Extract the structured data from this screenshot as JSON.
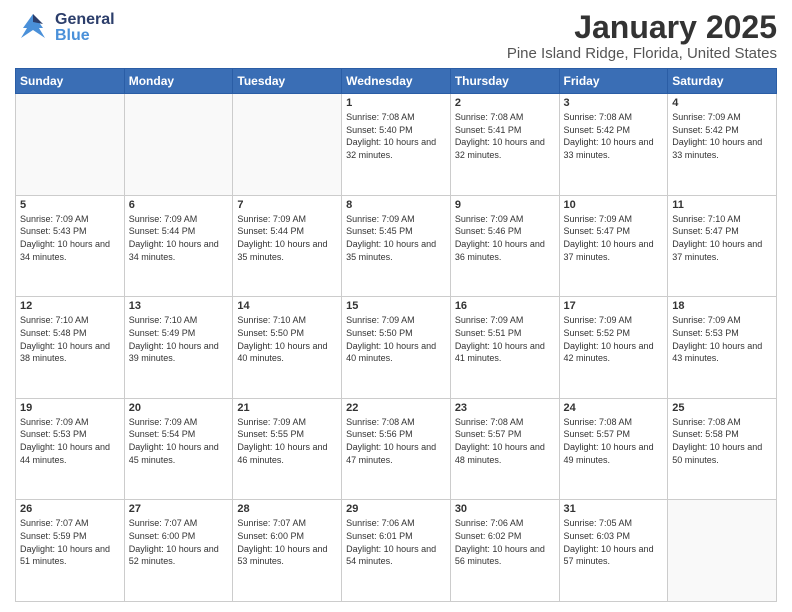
{
  "header": {
    "logo": {
      "general": "General",
      "blue": "Blue"
    },
    "title": "January 2025",
    "location": "Pine Island Ridge, Florida, United States"
  },
  "weekdays": [
    "Sunday",
    "Monday",
    "Tuesday",
    "Wednesday",
    "Thursday",
    "Friday",
    "Saturday"
  ],
  "weeks": [
    [
      {
        "day": "",
        "empty": true
      },
      {
        "day": "",
        "empty": true
      },
      {
        "day": "",
        "empty": true
      },
      {
        "day": "1",
        "sunrise": "7:08 AM",
        "sunset": "5:40 PM",
        "daylight": "10 hours and 32 minutes."
      },
      {
        "day": "2",
        "sunrise": "7:08 AM",
        "sunset": "5:41 PM",
        "daylight": "10 hours and 32 minutes."
      },
      {
        "day": "3",
        "sunrise": "7:08 AM",
        "sunset": "5:42 PM",
        "daylight": "10 hours and 33 minutes."
      },
      {
        "day": "4",
        "sunrise": "7:09 AM",
        "sunset": "5:42 PM",
        "daylight": "10 hours and 33 minutes."
      }
    ],
    [
      {
        "day": "5",
        "sunrise": "7:09 AM",
        "sunset": "5:43 PM",
        "daylight": "10 hours and 34 minutes."
      },
      {
        "day": "6",
        "sunrise": "7:09 AM",
        "sunset": "5:44 PM",
        "daylight": "10 hours and 34 minutes."
      },
      {
        "day": "7",
        "sunrise": "7:09 AM",
        "sunset": "5:44 PM",
        "daylight": "10 hours and 35 minutes."
      },
      {
        "day": "8",
        "sunrise": "7:09 AM",
        "sunset": "5:45 PM",
        "daylight": "10 hours and 35 minutes."
      },
      {
        "day": "9",
        "sunrise": "7:09 AM",
        "sunset": "5:46 PM",
        "daylight": "10 hours and 36 minutes."
      },
      {
        "day": "10",
        "sunrise": "7:09 AM",
        "sunset": "5:47 PM",
        "daylight": "10 hours and 37 minutes."
      },
      {
        "day": "11",
        "sunrise": "7:10 AM",
        "sunset": "5:47 PM",
        "daylight": "10 hours and 37 minutes."
      }
    ],
    [
      {
        "day": "12",
        "sunrise": "7:10 AM",
        "sunset": "5:48 PM",
        "daylight": "10 hours and 38 minutes."
      },
      {
        "day": "13",
        "sunrise": "7:10 AM",
        "sunset": "5:49 PM",
        "daylight": "10 hours and 39 minutes."
      },
      {
        "day": "14",
        "sunrise": "7:10 AM",
        "sunset": "5:50 PM",
        "daylight": "10 hours and 40 minutes."
      },
      {
        "day": "15",
        "sunrise": "7:09 AM",
        "sunset": "5:50 PM",
        "daylight": "10 hours and 40 minutes."
      },
      {
        "day": "16",
        "sunrise": "7:09 AM",
        "sunset": "5:51 PM",
        "daylight": "10 hours and 41 minutes."
      },
      {
        "day": "17",
        "sunrise": "7:09 AM",
        "sunset": "5:52 PM",
        "daylight": "10 hours and 42 minutes."
      },
      {
        "day": "18",
        "sunrise": "7:09 AM",
        "sunset": "5:53 PM",
        "daylight": "10 hours and 43 minutes."
      }
    ],
    [
      {
        "day": "19",
        "sunrise": "7:09 AM",
        "sunset": "5:53 PM",
        "daylight": "10 hours and 44 minutes."
      },
      {
        "day": "20",
        "sunrise": "7:09 AM",
        "sunset": "5:54 PM",
        "daylight": "10 hours and 45 minutes."
      },
      {
        "day": "21",
        "sunrise": "7:09 AM",
        "sunset": "5:55 PM",
        "daylight": "10 hours and 46 minutes."
      },
      {
        "day": "22",
        "sunrise": "7:08 AM",
        "sunset": "5:56 PM",
        "daylight": "10 hours and 47 minutes."
      },
      {
        "day": "23",
        "sunrise": "7:08 AM",
        "sunset": "5:57 PM",
        "daylight": "10 hours and 48 minutes."
      },
      {
        "day": "24",
        "sunrise": "7:08 AM",
        "sunset": "5:57 PM",
        "daylight": "10 hours and 49 minutes."
      },
      {
        "day": "25",
        "sunrise": "7:08 AM",
        "sunset": "5:58 PM",
        "daylight": "10 hours and 50 minutes."
      }
    ],
    [
      {
        "day": "26",
        "sunrise": "7:07 AM",
        "sunset": "5:59 PM",
        "daylight": "10 hours and 51 minutes."
      },
      {
        "day": "27",
        "sunrise": "7:07 AM",
        "sunset": "6:00 PM",
        "daylight": "10 hours and 52 minutes."
      },
      {
        "day": "28",
        "sunrise": "7:07 AM",
        "sunset": "6:00 PM",
        "daylight": "10 hours and 53 minutes."
      },
      {
        "day": "29",
        "sunrise": "7:06 AM",
        "sunset": "6:01 PM",
        "daylight": "10 hours and 54 minutes."
      },
      {
        "day": "30",
        "sunrise": "7:06 AM",
        "sunset": "6:02 PM",
        "daylight": "10 hours and 56 minutes."
      },
      {
        "day": "31",
        "sunrise": "7:05 AM",
        "sunset": "6:03 PM",
        "daylight": "10 hours and 57 minutes."
      },
      {
        "day": "",
        "empty": true
      }
    ]
  ]
}
